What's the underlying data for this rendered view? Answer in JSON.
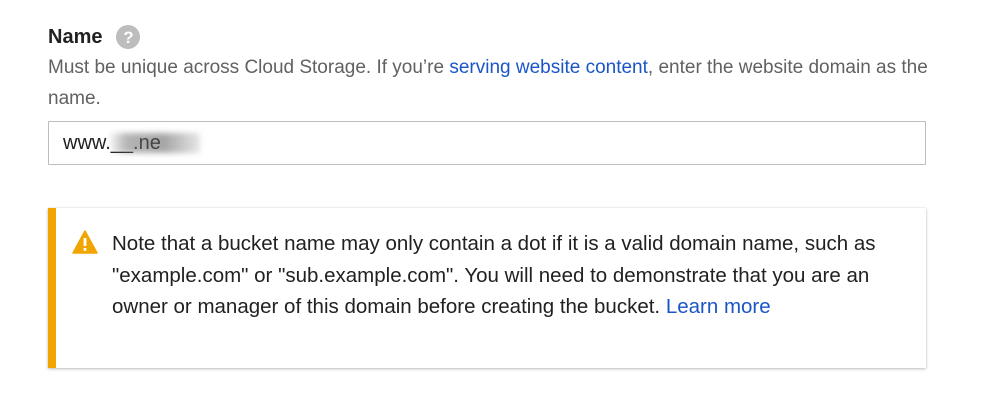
{
  "field": {
    "label": "Name",
    "help_icon": "question-icon",
    "description_before": "Must be unique across Cloud Storage. If you’re ",
    "description_link": "serving website content",
    "description_after": ", enter the website domain as the name.",
    "input_value": "www.__.ne"
  },
  "notice": {
    "icon": "warning-icon",
    "accent_color": "#f0a500",
    "text": "Note that a bucket name may only contain a dot if it is a valid domain name, such as \"example.com\" or \"sub.example.com\". You will need to demonstrate that you are an owner or manager of this domain before creating the bucket. ",
    "link": "Learn more"
  },
  "colors": {
    "link": "#1a55c8",
    "warning": "#f0a500"
  }
}
